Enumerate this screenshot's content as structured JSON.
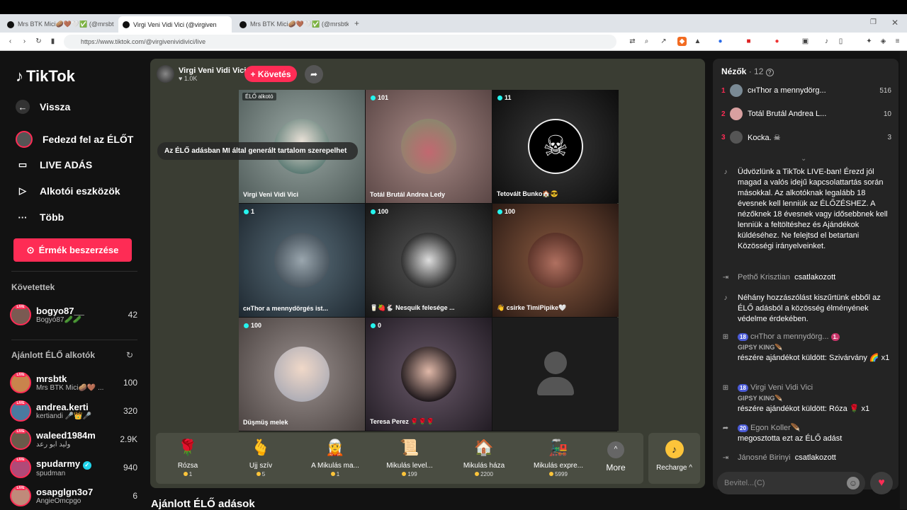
{
  "browser": {
    "tabs": [
      {
        "title": "Mrs BTK Mici🥔🤎🤍✅ (@mrsbt"
      },
      {
        "title": "Virgi Veni Vidi Vici (@virgiven"
      },
      {
        "title": "Mrs BTK Mici🥔🤎🤍✅ (@mrsbtk) É"
      }
    ],
    "url": "https://www.tiktok.com/@virgivenividivici/live"
  },
  "sidebar": {
    "logo": "TikTok",
    "nav": [
      {
        "label": "Vissza"
      },
      {
        "label": "Fedezd fel az ÉLŐT"
      },
      {
        "label": "LIVE ADÁS"
      },
      {
        "label": "Alkotói eszközök"
      },
      {
        "label": "Több"
      }
    ],
    "coins_button": "Érmék beszerzése",
    "following_title": "Követettek",
    "following": [
      {
        "username": "bogyo87__",
        "sub": "Bogyó87🥒🥒",
        "count": "42"
      }
    ],
    "recommended_title": "Ajánlott ÉLŐ alkotók",
    "recommended": [
      {
        "username": "mrsbtk",
        "sub": "Mrs BTK Mici🥔🤎 ...",
        "count": "100"
      },
      {
        "username": "andrea.kerti",
        "sub": "kertiandi 🎤👑🎤",
        "count": "320"
      },
      {
        "username": "waleed1984m",
        "sub": "وليد ابو رعد",
        "count": "2.9K"
      },
      {
        "username": "spudarmy",
        "sub": "spudman",
        "count": "940"
      },
      {
        "username": "osapglgn3o7",
        "sub": "AngieOmcpgo",
        "count": "6"
      }
    ],
    "live_badge": "LIVE"
  },
  "stream": {
    "host_name": "Virgi Veni Vidi Vici",
    "host_likes": "1.0K",
    "follow_label": "+ Követés",
    "ai_notice": "Az ÉLŐ adásban MI által generált tartalom szerepelhet",
    "creator_badge": "ÉLŐ alkotó",
    "cells": [
      {
        "count": "",
        "name": "Virgi Veni Vidi Vici",
        "color": "#6a7c79"
      },
      {
        "count": "101",
        "name": "Totál Brutál Andrea Ledy",
        "color": "#8a6a68"
      },
      {
        "count": "11",
        "name": "Tetovált Bunko🏠😎",
        "color": "#1a1a1a"
      },
      {
        "count": "1",
        "name": "ᴄʜThor a mennydörgés ist...",
        "color": "#3a4a55"
      },
      {
        "count": "100",
        "name": "🥛🍓🐇 Nesquik felesége ...",
        "color": "#2a2a2a"
      },
      {
        "count": "100",
        "name": "👋 csirke TimiPipike🤍",
        "color": "#5a3d33"
      },
      {
        "count": "100",
        "name": "Düşmüş melek",
        "color": "#6d6562"
      },
      {
        "count": "0",
        "name": "Teresa Perez 🌹🌹🌹",
        "color": "#3a3440"
      },
      {
        "count": "",
        "name": "",
        "color": "#1c1c1c"
      }
    ]
  },
  "gifts": [
    {
      "name": "Rózsa",
      "price": "1",
      "icon": "🌹"
    },
    {
      "name": "Ujj szív",
      "price": "5",
      "icon": "🫰"
    },
    {
      "name": "A Mikulás ma...",
      "price": "1",
      "icon": "🧝"
    },
    {
      "name": "Mikulás level...",
      "price": "199",
      "icon": "📜"
    },
    {
      "name": "Mikulás háza",
      "price": "2200",
      "icon": "🏠"
    },
    {
      "name": "Mikulás expre...",
      "price": "5999",
      "icon": "🚂"
    }
  ],
  "gift_more": "More",
  "recharge": "Recharge ^",
  "section_below": "Ajánlott ÉLŐ adások",
  "viewers": {
    "title": "Nézők",
    "count": "12",
    "list": [
      {
        "rank": "1",
        "name": "ᴄʜThor a mennydörg...",
        "score": "516",
        "color": "#7a8a95"
      },
      {
        "rank": "2",
        "name": "Totál Brutál Andrea L...",
        "score": "10",
        "color": "#d8a0a0"
      },
      {
        "rank": "3",
        "name": "Kocka. ☠",
        "score": "3",
        "color": "#555"
      }
    ]
  },
  "chat": {
    "welcome": "Üdvözlünk a TikTok LIVE-ban! Érezd jól magad a valós idejű kapcsolattartás során másokkal. Az alkotóknak legalább 18 évesnek kell lenniük az ÉLŐZÉSHEZ. A nézőknek 18 évesnek vagy idősebbnek kell lenniük a feltöltéshez és Ajándékok küldéséhez. Ne felejtsd el betartani Közösségi irányelveinket.",
    "join1_name": "Pethő Krisztian",
    "join1_text": "csatlakozott",
    "filter_note": "Néhány hozzászólást kiszűrtünk ebből az ÉLŐ adásból a közösség élményének védelme érdekében.",
    "gift1_level": "18",
    "gift1_name": "ᴄʜThor a mennydörg...",
    "gift1_badge": "1.",
    "gift1_sub": "GIPSY KING🪶",
    "gift1_text": "részére ajándékot küldött: Szivárvány 🌈 x1",
    "gift2_level": "18",
    "gift2_name": "Virgi Veni Vidi Vici",
    "gift2_sub": "GIPSY KING🪶",
    "gift2_text": "részére ajándékot küldött: Róza 🌹 x1",
    "share_level": "20",
    "share_name": "Egon Koller🪶",
    "share_text": "megosztotta ezt az ÉLŐ adást",
    "join2_name": "Jánosné Birinyi",
    "join2_text": "csatlakozott",
    "input_placeholder": "Bevitel...(C)"
  }
}
